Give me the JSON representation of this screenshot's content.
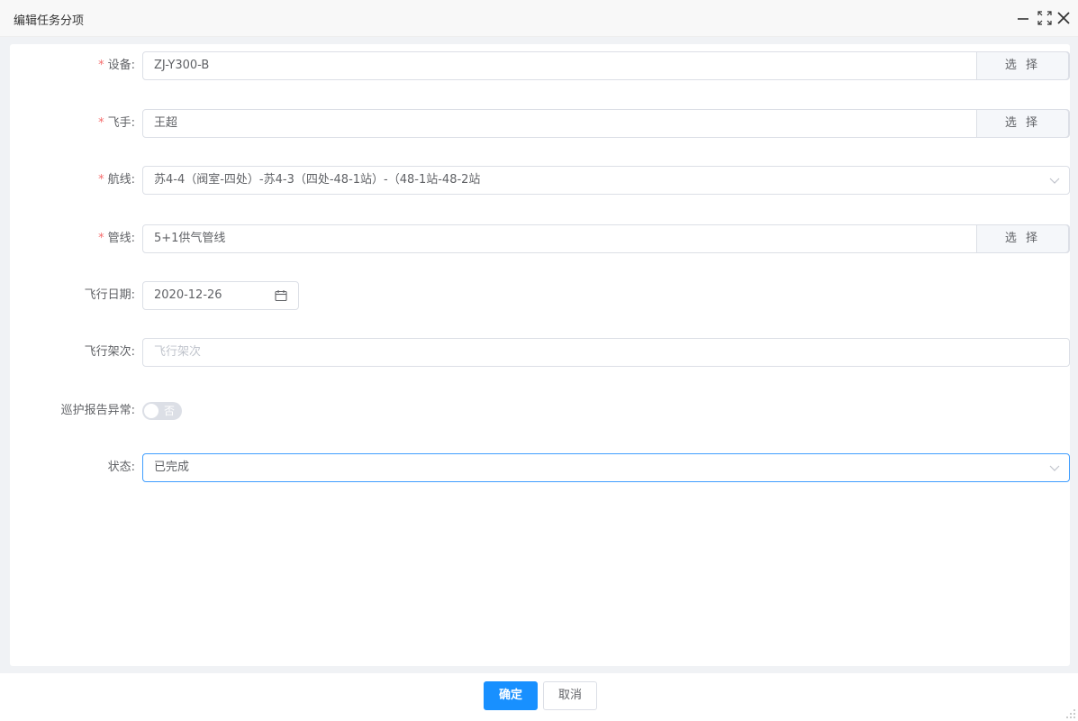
{
  "window": {
    "title": "编辑任务分项",
    "controls": [
      "minimize-icon",
      "maximize-icon",
      "close-icon"
    ]
  },
  "form": {
    "device": {
      "label": "设备",
      "required": true,
      "value": "ZJ-Y300-B",
      "button": "选 择"
    },
    "pilot": {
      "label": "飞手",
      "required": true,
      "value": "王超",
      "button": "选 择"
    },
    "route": {
      "label": "航线",
      "required": true,
      "value": "苏4-4（阀室-四处）-苏4-3（四处-48-1站）-（48-1站-48-2站"
    },
    "pipeline": {
      "label": "管线",
      "required": true,
      "value": "5+1供气管线",
      "button": "选 择"
    },
    "flight_date": {
      "label": "飞行日期",
      "value": "2020-12-26"
    },
    "sortie": {
      "label": "飞行架次",
      "placeholder": "飞行架次",
      "value": ""
    },
    "patrol_abnormal": {
      "label": "巡护报告异常",
      "switch_text": "否",
      "checked": false
    },
    "status": {
      "label": "状态",
      "value": "已完成"
    }
  },
  "footer": {
    "confirm": "确定",
    "cancel": "取消"
  },
  "colors": {
    "primary": "#1890ff",
    "required": "#f56c6c",
    "focus_border": "#409eff"
  }
}
